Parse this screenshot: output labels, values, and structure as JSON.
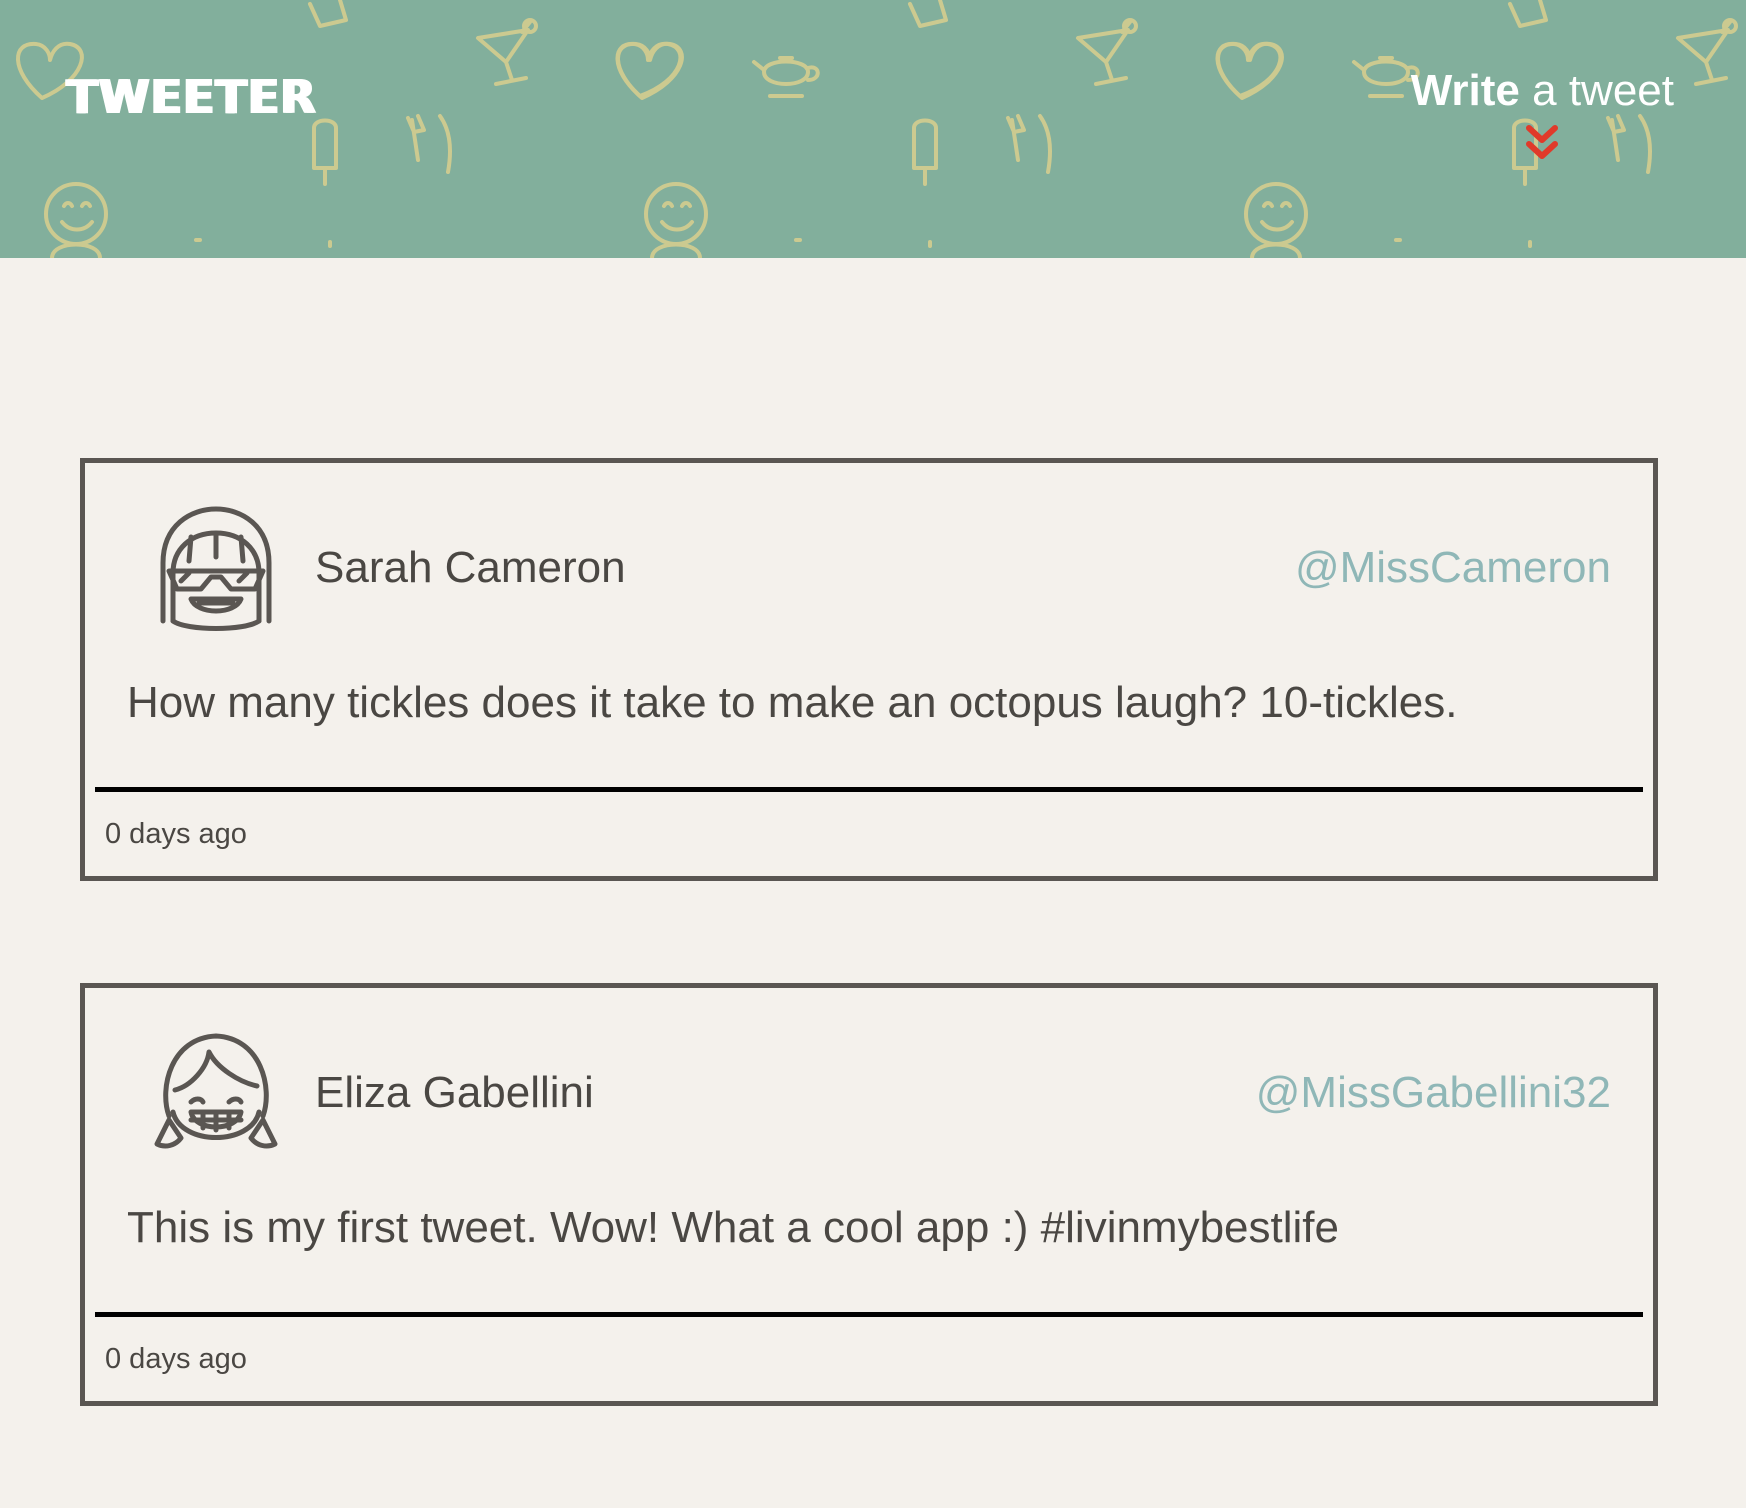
{
  "header": {
    "brand": "TWEETER",
    "compose_bold": "Write",
    "compose_rest": " a tweet",
    "background_color": "#82af9c",
    "accent_color": "#e03a2a"
  },
  "tweets": [
    {
      "name": "Sarah Cameron",
      "handle": "@MissCameron",
      "text": "How many tickles does it take to make an octopus laugh? 10-tickles.",
      "time": "0 days ago",
      "avatar_icon": "girl-sunglasses-icon"
    },
    {
      "name": "Eliza Gabellini",
      "handle": "@MissGabellini32",
      "text": "This is my first tweet. Wow! What a cool app :) #livinmybestlife",
      "time": "0 days ago",
      "avatar_icon": "girl-pigtails-icon"
    }
  ],
  "colors": {
    "page_bg": "#f4f1ec",
    "handle": "#8fb7b7",
    "border": "#5a5652"
  }
}
